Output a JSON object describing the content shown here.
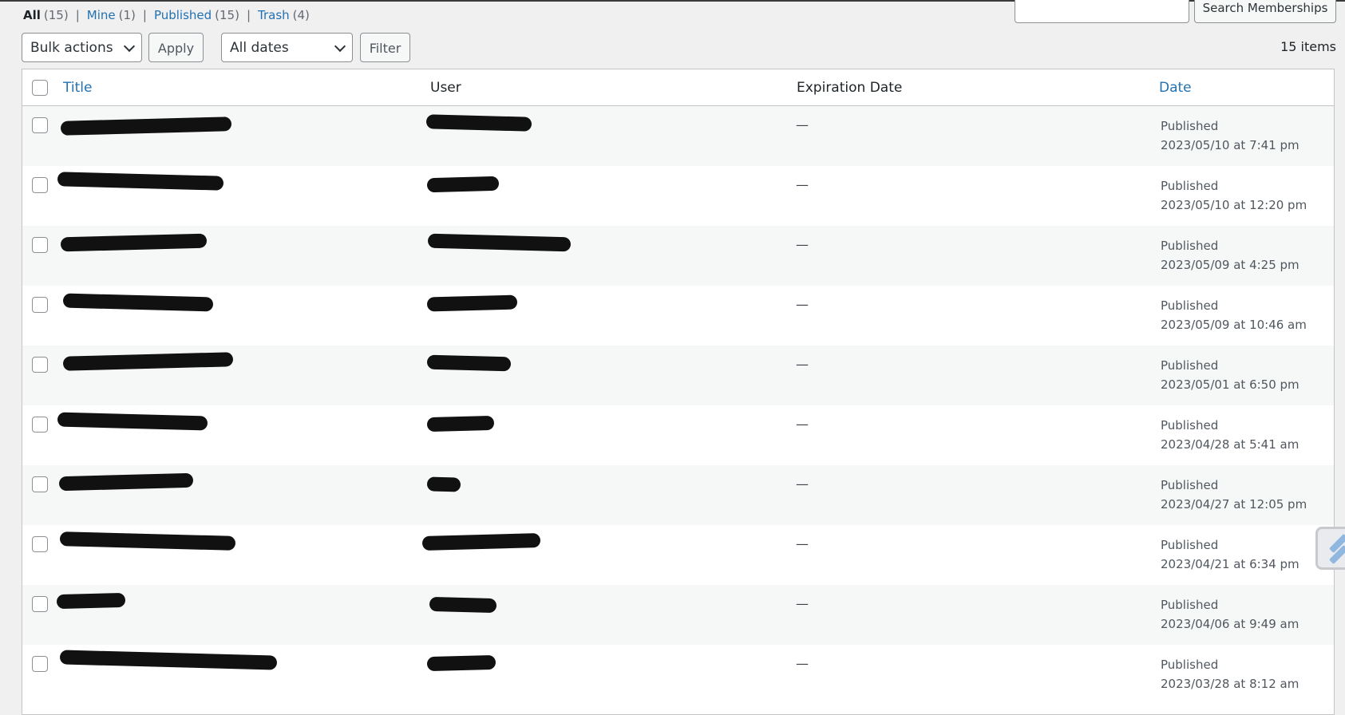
{
  "views": {
    "all_label": "All",
    "all_count": "(15)",
    "mine_label": "Mine",
    "mine_count": "(1)",
    "published_label": "Published",
    "published_count": "(15)",
    "trash_label": "Trash",
    "trash_count": "(4)",
    "separator": "|"
  },
  "search": {
    "value": "",
    "button_label": "Search Memberships"
  },
  "toolbar": {
    "bulk_actions_selected": "Bulk actions",
    "apply_label": "Apply",
    "dates_selected": "All dates",
    "filter_label": "Filter",
    "items_count": "15 items"
  },
  "table": {
    "columns": {
      "title": "Title",
      "user": "User",
      "expiration": "Expiration Date",
      "date": "Date"
    },
    "rows": [
      {
        "expiration": "—",
        "status": "Published",
        "date": "2023/05/10 at 7:41 pm"
      },
      {
        "expiration": "—",
        "status": "Published",
        "date": "2023/05/10 at 12:20 pm"
      },
      {
        "expiration": "—",
        "status": "Published",
        "date": "2023/05/09 at 4:25 pm"
      },
      {
        "expiration": "—",
        "status": "Published",
        "date": "2023/05/09 at 10:46 am"
      },
      {
        "expiration": "—",
        "status": "Published",
        "date": "2023/05/01 at 6:50 pm"
      },
      {
        "expiration": "—",
        "status": "Published",
        "date": "2023/04/28 at 5:41 am"
      },
      {
        "expiration": "—",
        "status": "Published",
        "date": "2023/04/27 at 12:05 pm"
      },
      {
        "expiration": "—",
        "status": "Published",
        "date": "2023/04/21 at 6:34 pm"
      },
      {
        "expiration": "—",
        "status": "Published",
        "date": "2023/04/06 at 9:49 am"
      },
      {
        "expiration": "—",
        "status": "Published",
        "date": "2023/03/28 at 8:12 am"
      }
    ]
  },
  "colors": {
    "link": "#2271b1",
    "text": "#3c434a",
    "background": "#f0f0f1"
  }
}
